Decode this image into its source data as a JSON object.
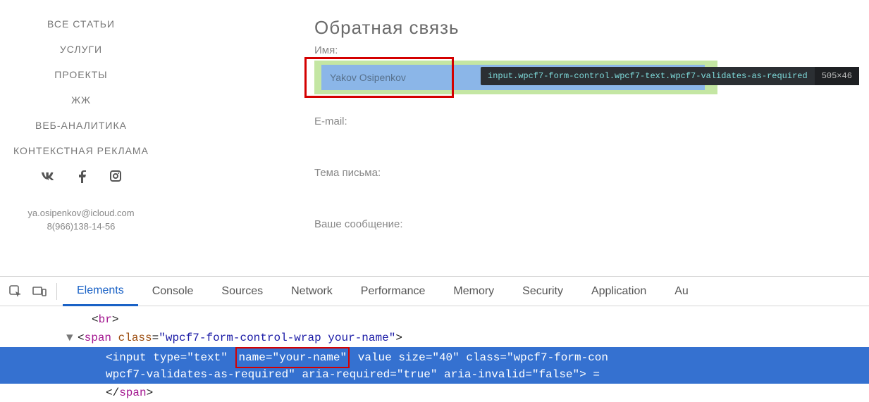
{
  "sidebar": {
    "items": [
      {
        "label": "ВСЕ СТАТЬИ"
      },
      {
        "label": "УСЛУГИ"
      },
      {
        "label": "ПРОЕКТЫ"
      },
      {
        "label": "ЖЖ"
      },
      {
        "label": "ВЕБ-АНАЛИТИКА"
      },
      {
        "label": "КОНТЕКСТНАЯ РЕКЛАМА"
      }
    ],
    "email": "ya.osipenkov@icloud.com",
    "phone": "8(966)138-14-56"
  },
  "form": {
    "heading": "Обратная связь",
    "name_label": "Имя:",
    "name_value": "Yakov Osipenkov",
    "email_label": "E-mail:",
    "subject_label": "Тема письма:",
    "message_label": "Ваше сообщение:"
  },
  "tooltip": {
    "selector": "input.wpcf7-form-control.wpcf7-text.wpcf7-validates-as-required",
    "dimensions": "505×46"
  },
  "devtools": {
    "tabs": [
      "Elements",
      "Console",
      "Sources",
      "Network",
      "Performance",
      "Memory",
      "Security",
      "Application",
      "Au"
    ],
    "active_tab": 0,
    "code": {
      "line1": "<br>",
      "span_open_tag": "span",
      "span_class_attr": "class",
      "span_class_val": "\"wpcf7-form-control-wrap your-name\"",
      "input_tag": "input",
      "type_attr": "type",
      "type_val": "\"text\"",
      "name_attr": "name",
      "name_val": "\"your-name\"",
      "rest1_a": "value size",
      "rest1_eq": "=",
      "rest1_v": "\"40\"",
      "rest1_b": " class",
      "rest1_v2": "\"wpcf7-form-con",
      "line2_a": "wpcf7-validates-as-required\"",
      "line2_b": " aria-required",
      "line2_bv": "\"true\"",
      "line2_c": " aria-invalid",
      "line2_cv": "\"false\"",
      "line2_end": "> =",
      "close": "</span>"
    }
  }
}
